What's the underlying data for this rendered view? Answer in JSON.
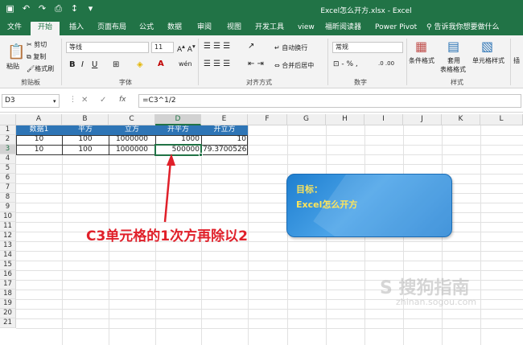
{
  "titlebar": {
    "title": "Excel怎么开方.xlsx  -  Excel"
  },
  "tabs": [
    "文件",
    "开始",
    "插入",
    "页面布局",
    "公式",
    "数据",
    "审阅",
    "视图",
    "开发工具",
    "view",
    "福昕阅读器",
    "Power Pivot"
  ],
  "active_tab": "开始",
  "tell_me": "告诉我你想要做什么",
  "ribbon": {
    "clipboard": {
      "paste": "粘贴",
      "cut": "剪切",
      "copy": "复制",
      "format_painter": "格式刷",
      "label": "剪贴板"
    },
    "font": {
      "name": "等线",
      "size": "11",
      "label": "字体"
    },
    "alignment": {
      "wrap": "自动换行",
      "merge": "合并后居中",
      "label": "对齐方式"
    },
    "number": {
      "format": "常规",
      "label": "数字"
    },
    "styles": {
      "conditional": "条件格式",
      "table": "套用",
      "table2": "表格格式",
      "cell": "单元格样式",
      "label": "样式"
    },
    "insert": "插"
  },
  "formula_bar": {
    "name_box": "D3",
    "formula": "=C3^1/2"
  },
  "columns": [
    "A",
    "B",
    "C",
    "D",
    "E",
    "F",
    "G",
    "H",
    "I",
    "J",
    "K",
    "L"
  ],
  "selected_column": "D",
  "rows": [
    "1",
    "2",
    "3",
    "4",
    "5",
    "6",
    "7",
    "8",
    "9",
    "10",
    "11",
    "12",
    "13",
    "14",
    "15",
    "16",
    "17",
    "18",
    "19",
    "20",
    "21"
  ],
  "selected_row": "3",
  "table": {
    "headers": [
      "数据1",
      "平方",
      "立方",
      "开平方",
      "开立方"
    ],
    "row2": [
      "10",
      "100",
      "1000000",
      "1000",
      "10"
    ],
    "row3": [
      "10",
      "100",
      "1000000",
      "500000",
      "79.3700526"
    ]
  },
  "annotation": "C3单元格的1次方再除以2",
  "goal": {
    "line1": "目标：",
    "line2": "Excel怎么开方"
  },
  "watermark": {
    "main": "S 搜狗指南",
    "sub": "zhinan.sogou.com"
  },
  "colors": {
    "excel_green": "#217346",
    "header_blue": "#2e75b6",
    "callout_red": "#e0202a",
    "goal_yellow": "#ffe55a"
  }
}
